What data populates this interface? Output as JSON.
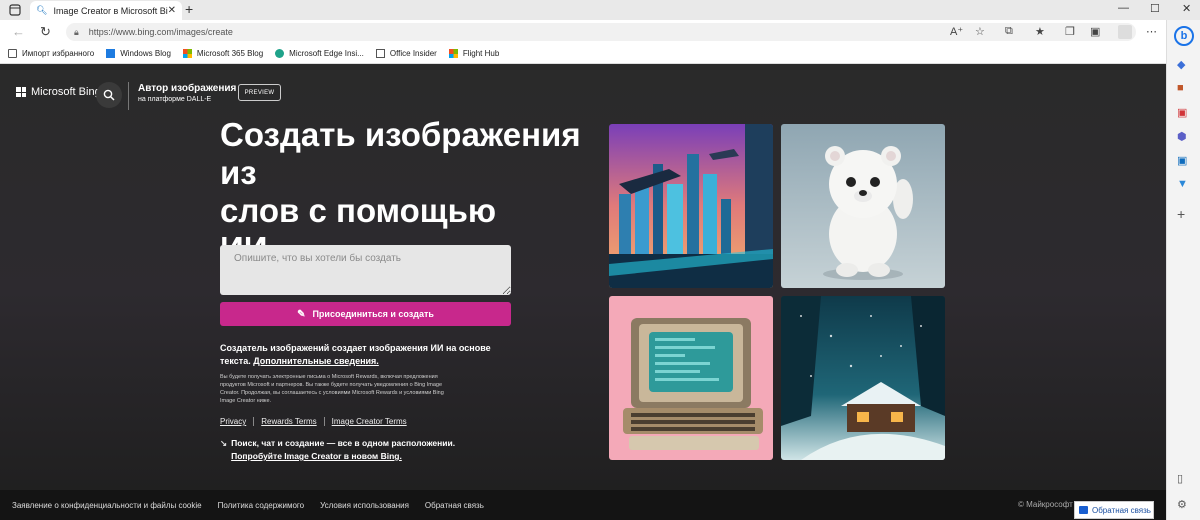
{
  "browser": {
    "tab_title": "Image Creator в Microsoft Bing",
    "url": "https://www.bing.com/images/create",
    "favorites": [
      {
        "label": "Импорт избранного"
      },
      {
        "label": "Windows Blog"
      },
      {
        "label": "Microsoft 365 Blog"
      },
      {
        "label": "Microsoft Edge Insi..."
      },
      {
        "label": "Office Insider"
      },
      {
        "label": "Flight Hub"
      }
    ]
  },
  "header": {
    "logo_text": "Microsoft Bing",
    "product_title": "Автор изображения",
    "product_subtitle": "на платформе DALL-E",
    "preview_badge": "PREVIEW"
  },
  "main": {
    "hero_line1": "Создать изображения из",
    "hero_line2": "слов с помощью",
    "hero_line3": "ИИ",
    "prompt_placeholder": "Опишите, что вы хотели бы создать",
    "join_button": "Присоединиться и создать",
    "desc_text": "Создатель изображений создает изображения ИИ на основе текста.",
    "desc_link": "Дополнительные сведения.",
    "fine_print": "Вы будете получать электронные письма о Microsoft Rewards, включая предложения продуктов Microsoft и партнеров. Вы также будете получать уведомления о Bing Image Creator. Продолжая, вы соглашаетесь с условиями Microsoft Rewards и условиями Bing Image Creator ниже.",
    "link_privacy": "Privacy",
    "link_rewards": "Rewards Terms",
    "link_creator": "Image Creator Terms",
    "promo_text": "Поиск, чат и создание — все в одном расположении.",
    "promo_link": "Попробуйте Image Creator в новом Bing."
  },
  "footer": {
    "items": [
      "Заявление о конфиденциальности и файлы cookie",
      "Политика содержимого",
      "Условия использования",
      "Обратная связь"
    ],
    "copyright": "© Майкрософт",
    "feedback_button": "Обратная связь"
  },
  "colors": {
    "accent": "#c8288c",
    "page_bg": "#2a2a2a"
  }
}
